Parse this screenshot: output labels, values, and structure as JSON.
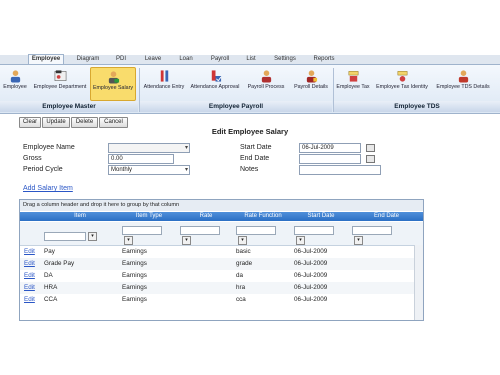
{
  "tabs": [
    "Employee",
    "Diagram",
    "PDI",
    "Leave",
    "Loan",
    "Payroll",
    "List",
    "Settings",
    "Reports"
  ],
  "ribbon": {
    "buttons": [
      "Employee",
      "Employee Department",
      "Employee Salary",
      "Attendance Entry",
      "Attendance Approval",
      "Payroll Process",
      "Payroll Details",
      "Employee Tax",
      "Employee Tax Identity",
      "Employee TDS Details"
    ],
    "groups": [
      "Employee Master",
      "Employee Payroll",
      "Employee TDS"
    ]
  },
  "toolbar": {
    "clear": "Clear",
    "update": "Update",
    "delete": "Delete",
    "cancel": "Cancel"
  },
  "form": {
    "title": "Edit Employee Salary",
    "employee_name_label": "Employee Name",
    "employee_name_value": "",
    "gross_label": "Gross",
    "gross_value": "0.00",
    "period_cycle_label": "Period Cycle",
    "period_cycle_value": "Monthly",
    "start_date_label": "Start Date",
    "start_date_value": "06-Jul-2009",
    "end_date_label": "End Date",
    "end_date_value": "",
    "notes_label": "Notes",
    "notes_value": "",
    "add_salary_item": "Add Salary Item"
  },
  "grid": {
    "group_hint": "Drag a column header and drop it here to group by that column",
    "columns": [
      "Item",
      "Item Type",
      "Rate",
      "Rate Function",
      "Start Date",
      "End Date"
    ],
    "rows": [
      {
        "edit": "Edit",
        "item": "Pay",
        "type": "Earnings",
        "rate": "",
        "func": "basic",
        "start": "06-Jul-2009",
        "end": ""
      },
      {
        "edit": "Edit",
        "item": "Grade Pay",
        "type": "Earnings",
        "rate": "",
        "func": "grade",
        "start": "06-Jul-2009",
        "end": ""
      },
      {
        "edit": "Edit",
        "item": "DA",
        "type": "Earnings",
        "rate": "",
        "func": "da",
        "start": "06-Jul-2009",
        "end": ""
      },
      {
        "edit": "Edit",
        "item": "HRA",
        "type": "Earnings",
        "rate": "",
        "func": "hra",
        "start": "06-Jul-2009",
        "end": ""
      },
      {
        "edit": "Edit",
        "item": "CCA",
        "type": "Earnings",
        "rate": "",
        "func": "cca",
        "start": "06-Jul-2009",
        "end": ""
      }
    ]
  },
  "colors": {
    "header_blue": "#2b6fc4",
    "selected_ribbon": "#f9dc6c",
    "link": "#2a56c6"
  }
}
